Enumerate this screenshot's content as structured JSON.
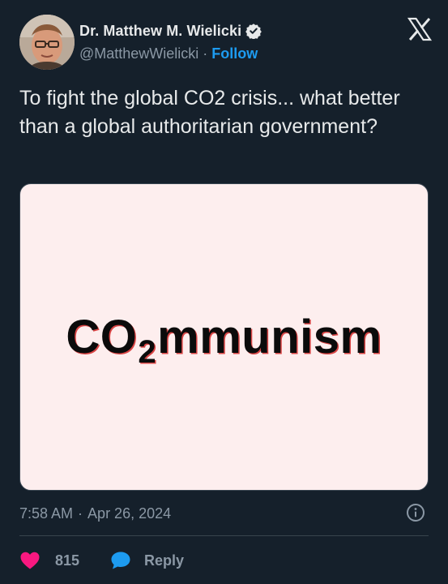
{
  "author": {
    "display_name": "Dr. Matthew M. Wielicki",
    "handle": "@MatthewWielicki",
    "separator": "·",
    "follow_label": "Follow",
    "verified": true
  },
  "tweet": {
    "text": "To fight the global CO2 crisis... what better than a global authoritarian government?"
  },
  "media": {
    "word_prefix": "CO",
    "word_subscript": "2",
    "word_suffix": "mmunism"
  },
  "meta": {
    "time": "7:58 AM",
    "separator": "·",
    "date": "Apr 26, 2024"
  },
  "actions": {
    "like_count": "815",
    "reply_label": "Reply"
  },
  "icons": {
    "verified": "verified-badge-icon",
    "logo": "x-logo-icon",
    "info": "info-icon",
    "like": "heart-icon",
    "reply": "speech-bubble-icon"
  },
  "colors": {
    "background": "#15202b",
    "text": "#e7e9ea",
    "muted": "#8b98a5",
    "accent": "#1d9bf0",
    "like": "#f91880",
    "media_background": "#fdeeee"
  }
}
